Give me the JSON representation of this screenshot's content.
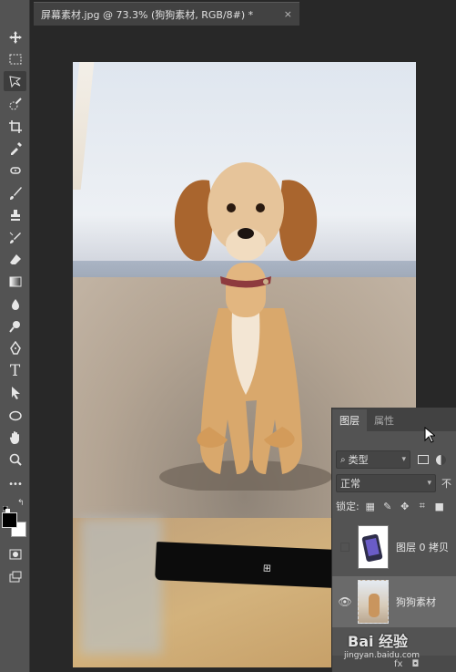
{
  "document_tab": {
    "title": "屏幕素材.jpg @ 73.3% (狗狗素材, RGB/8#) *",
    "close": "×"
  },
  "toolbar": {
    "tools": [
      "move-tool",
      "marquee-tool",
      "lasso-tool",
      "quick-select-tool",
      "crop-tool",
      "eyedropper-tool",
      "healing-tool",
      "brush-tool",
      "stamp-tool",
      "history-brush-tool",
      "eraser-tool",
      "gradient-tool",
      "blur-tool",
      "dodge-tool",
      "pen-tool",
      "type-tool",
      "path-select-tool",
      "ellipse-tool",
      "hand-tool",
      "zoom-tool",
      "more-tools"
    ],
    "type_glyph": "T",
    "more_glyph": "•••"
  },
  "colors": {
    "foreground": "#000000",
    "background": "#ffffff"
  },
  "canvas": {
    "windows_glyph": "⊞"
  },
  "layers_panel": {
    "tabs": [
      {
        "label": "图层"
      },
      {
        "label": "属性"
      }
    ],
    "filter_label": "类型",
    "blend_mode": "正常",
    "opacity_prefix": "不",
    "lock_label": "锁定:",
    "layers": [
      {
        "name": "图层 0 拷贝",
        "visible": false
      },
      {
        "name": "狗狗素材",
        "visible": true
      }
    ]
  },
  "watermark": {
    "main": "Bai 经验",
    "sub": "jingyan.baidu.com"
  }
}
